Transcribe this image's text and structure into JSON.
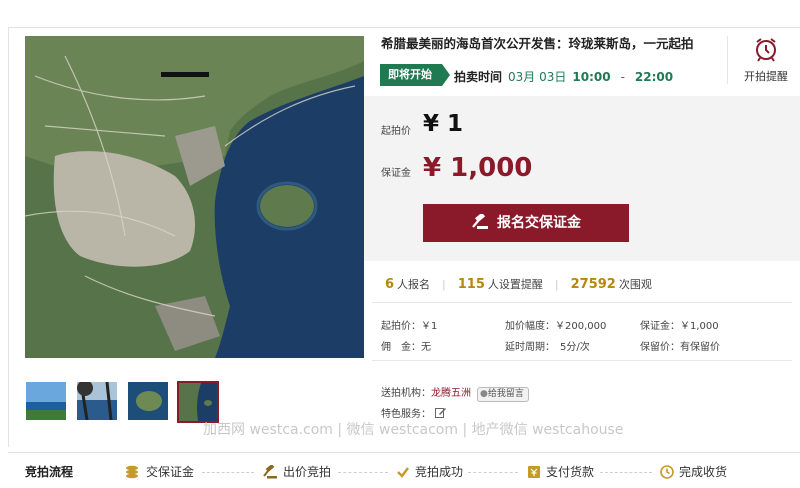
{
  "auction": {
    "title": "希腊最美丽的海岛首次公开发售：玲珑莱斯岛，一元起拍",
    "status_tag": "即将开始",
    "time_label": "拍卖时间",
    "date": "03月 03日",
    "start_time": "10:00",
    "time_sep": "-",
    "end_time": "22:00",
    "remind_label": "开拍提醒"
  },
  "price": {
    "start_label": "起拍价",
    "start_value": "¥ 1",
    "deposit_label": "保证金",
    "deposit_value": "¥ 1,000",
    "button_label": "报名交保证金"
  },
  "stats": {
    "signups": "6",
    "signups_label": "人报名",
    "reminders": "115",
    "reminders_label": "人设置提醒",
    "views": "27592",
    "views_label": "次围观"
  },
  "details": {
    "start_price": "起拍价：￥1",
    "increment": "加价幅度：￥200,000",
    "deposit": "保证金：￥1,000",
    "commission": "佣　金：无",
    "delay": "延时周期：　5分/次",
    "reserve": "保留价：有保留价"
  },
  "agency": {
    "label": "送拍机构：",
    "name": "龙腾五洲",
    "message": "给我留言",
    "service_label": "特色服务："
  },
  "watermark": "加西网 westca.com | 微信 westcacom | 地产微信 westcahouse",
  "flow": {
    "title": "竞拍流程",
    "steps": [
      "交保证金",
      "出价竞拍",
      "竞拍成功",
      "支付货款",
      "完成收货"
    ]
  },
  "colors": {
    "accent_red": "#8a1a2a",
    "accent_green": "#1f7a52",
    "stat_gold": "#b8860b"
  }
}
